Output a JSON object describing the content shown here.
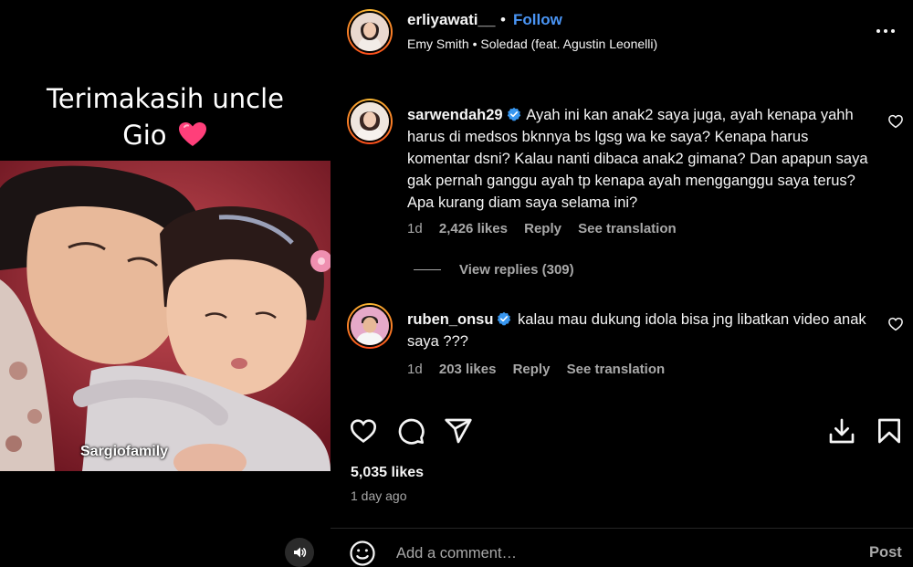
{
  "video": {
    "caption_line1": "Terimakasih uncle",
    "caption_line2": "Gio",
    "watermark": "Sargiofamily",
    "heart_color": "#ff3f7a",
    "icons": {
      "sound": "volume-icon",
      "heart": "heart-emoji-icon"
    }
  },
  "header": {
    "username": "erliyawati__",
    "separator": "•",
    "follow_label": "Follow",
    "audio": "Emy Smith • Soledad (feat. Agustin Leonelli)",
    "more_icon": "more-options-icon"
  },
  "comments": [
    {
      "username": "sarwendah29",
      "verified": true,
      "text": "Ayah ini kan anak2 saya juga, ayah kenapa yahh harus di medsos bknnya bs lgsg wa ke saya? Kenapa harus komentar dsni? Kalau nanti dibaca anak2 gimana? Dan apapun saya gak pernah ganggu ayah tp kenapa ayah mengganggu saya terus? Apa kurang diam saya selama ini?",
      "age": "1d",
      "likes": "2,426 likes",
      "reply_label": "Reply",
      "translate_label": "See translation",
      "view_replies": "View replies (309)"
    },
    {
      "username": "ruben_onsu",
      "verified": true,
      "text": "kalau mau dukung idola bisa jng libatkan video anak saya ???",
      "age": "1d",
      "likes": "203 likes",
      "reply_label": "Reply",
      "translate_label": "See translation"
    }
  ],
  "actions": {
    "icons": [
      "like-icon",
      "comment-icon",
      "share-icon",
      "download-icon",
      "save-icon"
    ]
  },
  "post": {
    "likes": "5,035 likes",
    "date": "1 day ago"
  },
  "composer": {
    "placeholder": "Add a comment…",
    "post_label": "Post"
  },
  "colors": {
    "background": "#000000",
    "text": "#f5f5f5",
    "secondary": "#a8a8a8",
    "link": "#4a95f5",
    "verified": "#3897f0",
    "divider": "#262626"
  }
}
